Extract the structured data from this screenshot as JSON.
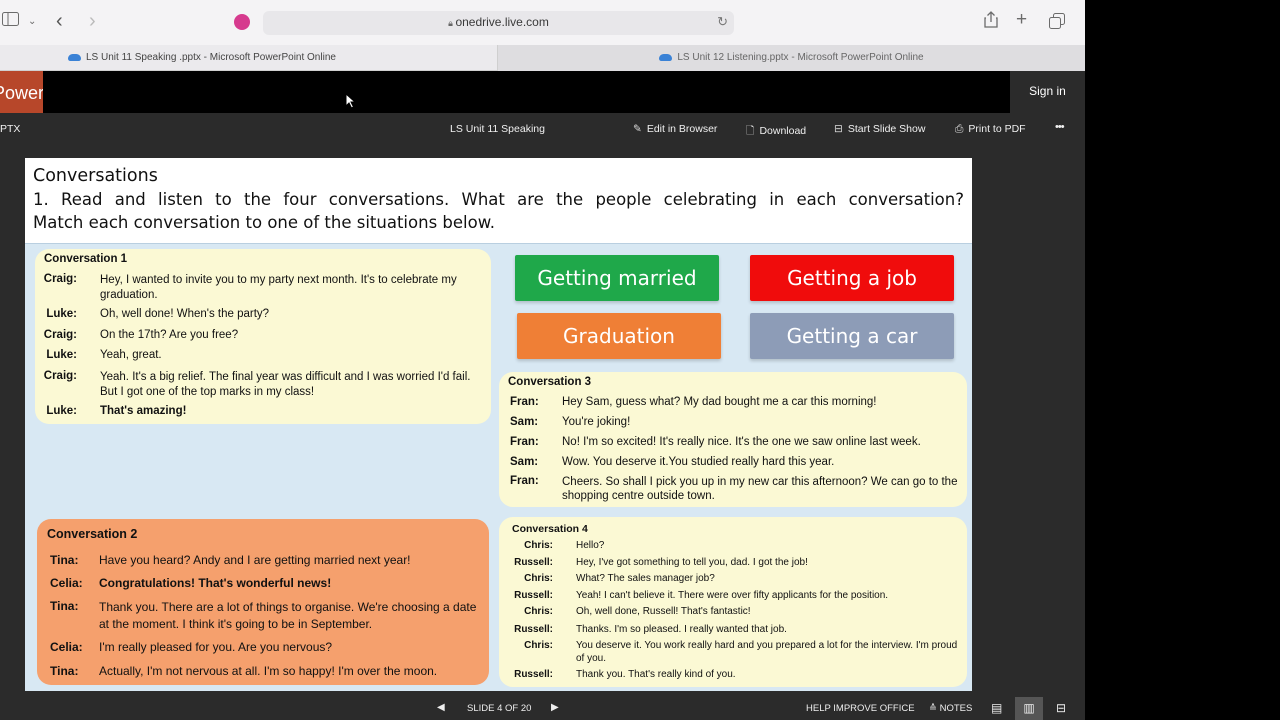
{
  "browser": {
    "url": "onedrive.live.com",
    "tabs": [
      {
        "label": "LS Unit 11 Speaking .pptx - Microsoft PowerPoint Online"
      },
      {
        "label": "LS Unit 12 Listening.pptx - Microsoft PowerPoint Online"
      }
    ]
  },
  "office": {
    "app_name": "PowerPoint",
    "sign_in": "Sign in",
    "file_ext": "PTX",
    "file_name": "LS Unit 11 Speaking",
    "commands": {
      "edit": "Edit in Browser",
      "download": "Download",
      "slideshow": "Start Slide Show",
      "print": "Print to PDF",
      "more": "•••"
    }
  },
  "slide": {
    "title": "Conversations",
    "instruction_line1": "1. Read and listen to the four conversations. What are the people celebrating in each conversation?",
    "instruction_line2": "Match each conversation to one of the situations below.",
    "situations": [
      {
        "label": "Getting married",
        "color": "#1fa84a"
      },
      {
        "label": "Getting a job",
        "color": "#f00c0c"
      },
      {
        "label": "Graduation",
        "color": "#ef7f36"
      },
      {
        "label": "Getting a car",
        "color": "#8d9cb7"
      }
    ],
    "conv1": {
      "title": "Conversation 1",
      "lines": [
        {
          "speaker": "Craig:",
          "text": "Hey, I wanted to invite you to my party next month. It's to celebrate my graduation."
        },
        {
          "speaker": "Luke:",
          "text": "Oh, well done! When's the party?"
        },
        {
          "speaker": "Craig:",
          "text": "On the 17th? Are you free?"
        },
        {
          "speaker": "Luke:",
          "text": "Yeah, great."
        },
        {
          "speaker": "Craig:",
          "text": "Yeah. It's a big relief. The final year was difficult and I was worried I'd fail. But I got one of the top marks in my class!"
        },
        {
          "speaker": "Luke:",
          "text": "That's amazing!"
        }
      ]
    },
    "conv2": {
      "title": "Conversation 2",
      "lines": [
        {
          "speaker": "Tina:",
          "text": "Have you heard? Andy and I are getting married next year!"
        },
        {
          "speaker": "Celia:",
          "text": "Congratulations! That's wonderful news!"
        },
        {
          "speaker": "Tina:",
          "text": "Thank you. There are a lot of things to organise. We're choosing a date at the moment. I think it's going to be in September."
        },
        {
          "speaker": "Celia:",
          "text": "I'm really pleased for you. Are you nervous?"
        },
        {
          "speaker": "Tina:",
          "text": "Actually, I'm not nervous at all. I'm so happy! I'm over the moon."
        }
      ]
    },
    "conv3": {
      "title": "Conversation 3",
      "lines": [
        {
          "speaker": "Fran:",
          "text": "Hey Sam, guess what? My dad bought me a car this morning!"
        },
        {
          "speaker": "Sam:",
          "text": "You're joking!"
        },
        {
          "speaker": "Fran:",
          "text": "No! I'm so excited! It's really nice. It's the one we saw online last week."
        },
        {
          "speaker": "Sam:",
          "text": "Wow. You deserve it.You studied really hard this year."
        },
        {
          "speaker": "Fran:",
          "text": "Cheers. So shall I pick you up in my new car this afternoon? We can go to the shopping centre outside town."
        }
      ]
    },
    "conv4": {
      "title": "Conversation 4",
      "lines": [
        {
          "speaker": "Chris:",
          "text": "Hello?"
        },
        {
          "speaker": "Russell:",
          "text": "Hey, I've got something to tell you, dad. I got the job!"
        },
        {
          "speaker": "Chris:",
          "text": "What? The sales manager job?"
        },
        {
          "speaker": "Russell:",
          "text": "Yeah! I can't believe it. There were over fifty applicants for the position."
        },
        {
          "speaker": "Chris:",
          "text": "Oh, well done, Russell! That's fantastic!"
        },
        {
          "speaker": "Russell:",
          "text": "Thanks. I'm so pleased. I really wanted that job."
        },
        {
          "speaker": "Chris:",
          "text": "You deserve it. You work really hard and you prepared a lot for the interview. I'm proud of you."
        },
        {
          "speaker": "Russell:",
          "text": "Thank you. That's really kind of you."
        }
      ]
    }
  },
  "status": {
    "slide_counter": "SLIDE 4 OF 20",
    "help": "HELP IMPROVE OFFICE",
    "notes": "NOTES"
  }
}
